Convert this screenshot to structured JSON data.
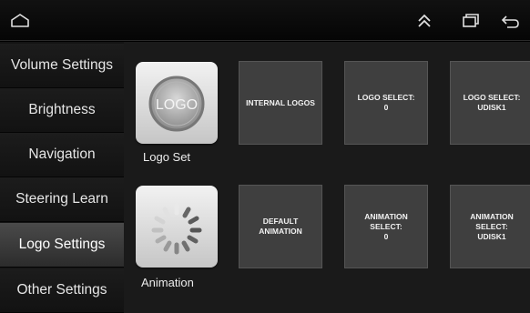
{
  "topbar": {
    "icons": [
      "home-icon",
      "collapse-up-icon",
      "recent-apps-icon",
      "back-icon"
    ]
  },
  "sidebar": {
    "items": [
      {
        "label": "Volume Settings"
      },
      {
        "label": "Brightness"
      },
      {
        "label": "Navigation"
      },
      {
        "label": "Steering Learn"
      },
      {
        "label": "Logo Settings",
        "active": true
      },
      {
        "label": "Other Settings"
      }
    ]
  },
  "logo_row": {
    "icon_text": "LOGO",
    "caption": "Logo Set",
    "tiles": [
      {
        "label": "INTERNAL LOGOS"
      },
      {
        "label": "LOGO SELECT:\n0"
      },
      {
        "label": "LOGO SELECT:\nUDISK1"
      }
    ]
  },
  "animation_row": {
    "caption": "Animation",
    "tiles": [
      {
        "label": "DEFAULT\nANIMATION"
      },
      {
        "label": "ANIMATION\nSELECT:\n0"
      },
      {
        "label": "ANIMATION\nSELECT:\nUDISK1"
      }
    ]
  },
  "colors": {
    "background": "#000000",
    "active_item": "#3a3a3a",
    "tile": "#3f3f3f"
  }
}
